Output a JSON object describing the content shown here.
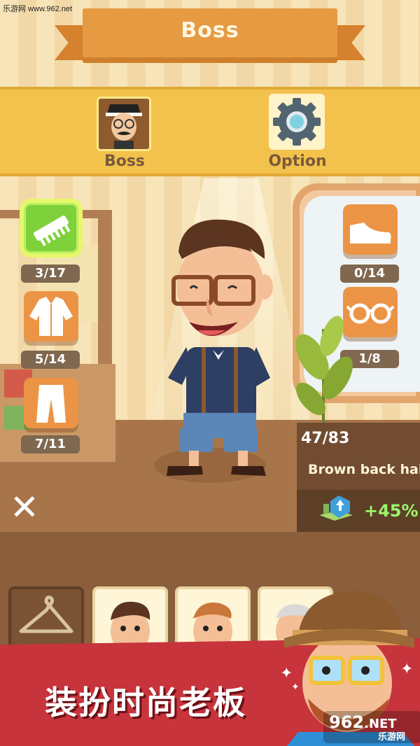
{
  "watermark": "乐游网 www.962.net",
  "header": {
    "title": "Boss"
  },
  "menu": {
    "tabs": [
      {
        "label": "Boss",
        "icon": "boss-avatar-icon"
      },
      {
        "label": "Option",
        "icon": "gear-icon"
      }
    ]
  },
  "wardrobe": {
    "left": [
      {
        "icon": "comb-icon",
        "count": "3/17"
      },
      {
        "icon": "jacket-icon",
        "count": "5/14"
      },
      {
        "icon": "pants-icon",
        "count": "7/11"
      }
    ],
    "right": [
      {
        "icon": "shoe-icon",
        "count": "0/14"
      },
      {
        "icon": "glasses-icon",
        "count": "1/8"
      }
    ]
  },
  "item_info": {
    "progress": "47/83",
    "name": "Brown back hair",
    "bonus": "+45%"
  },
  "close": {
    "icon": "close-icon"
  },
  "promo": {
    "text": "装扮时尚老板",
    "logo_num": "962",
    "logo_net": ".NET",
    "logo_sub": "乐游网"
  },
  "colors": {
    "banner": "#e69a42",
    "menubar": "#f3c24c",
    "accent_green": "#7ed13b",
    "accent_orange": "#ec9445",
    "promo_red": "#c7343b"
  }
}
